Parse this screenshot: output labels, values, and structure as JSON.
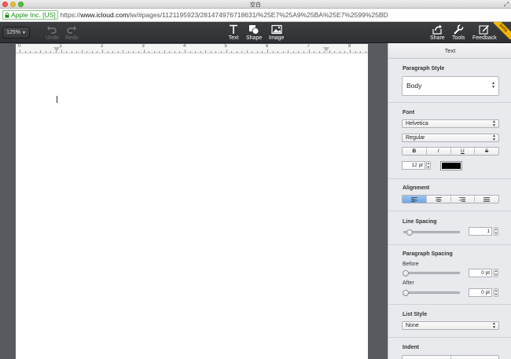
{
  "window": {
    "title": "空白"
  },
  "address": {
    "ssl_label": "Apple Inc. [US]",
    "url_scheme": "https://",
    "url_host": "www.icloud.com",
    "url_path": "/iw/#pages/1121195923/281474976718631/%25E7%25A9%25BA%25E7%2599%25BD"
  },
  "toolbar": {
    "zoom": "125%",
    "undo": "Undo",
    "redo": "Redo",
    "text": "Text",
    "shape": "Shape",
    "image": "Image",
    "share": "Share",
    "tools": "Tools",
    "feedback": "Feedback",
    "beta": "beta"
  },
  "ruler": {
    "numbers": [
      "0",
      "1",
      "2",
      "3",
      "4",
      "5",
      "6",
      "7",
      "8"
    ]
  },
  "inspector": {
    "header": "Text",
    "paragraph_style": {
      "title": "Paragraph Style",
      "value": "Body"
    },
    "font": {
      "title": "Font",
      "family": "Helvetica",
      "typeface": "Regular",
      "bold": "B",
      "italic": "I",
      "underline": "U",
      "strike": "S",
      "size": "12 pt",
      "color": "#000000"
    },
    "alignment": {
      "title": "Alignment",
      "selected": "left"
    },
    "line_spacing": {
      "title": "Line Spacing",
      "value": "1"
    },
    "paragraph_spacing": {
      "title": "Paragraph Spacing",
      "before_label": "Before",
      "before_value": "0 pt",
      "after_label": "After",
      "after_value": "0 pt"
    },
    "list_style": {
      "title": "List Style",
      "value": "None"
    },
    "indent": {
      "title": "Indent"
    }
  },
  "colors": {
    "close": "#fc5b57",
    "minimize": "#e5bf3c",
    "zoom": "#57c038",
    "ssl_green": "#1a8f1a"
  }
}
